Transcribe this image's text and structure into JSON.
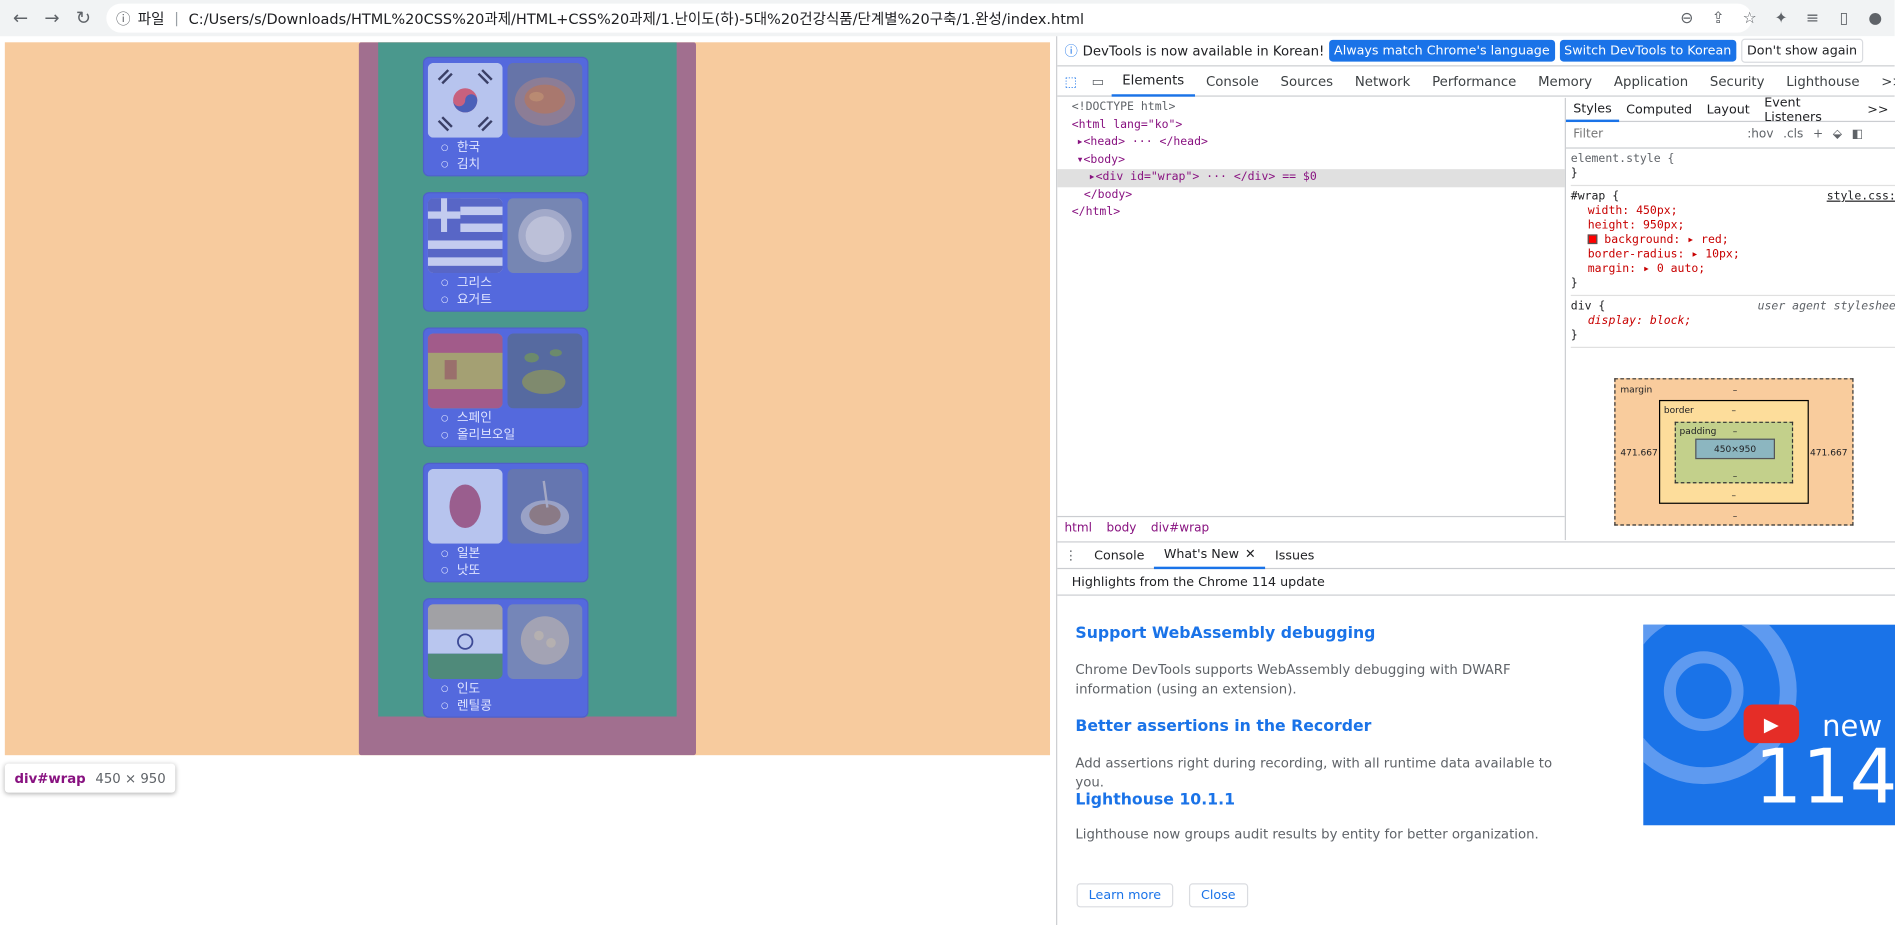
{
  "browser": {
    "url_prefix": "파일",
    "url": "C:/Users/s/Downloads/HTML%20CSS%20과제/HTML+CSS%20과제/1.난이도(하)-5대%20건강식품/단계별%20구축/1.완성/index.html"
  },
  "page": {
    "cards": [
      {
        "country": "한국",
        "food": "김치",
        "flag": "korea-flag-icon"
      },
      {
        "country": "그리스",
        "food": "요거트",
        "flag": "greece-flag-icon"
      },
      {
        "country": "스페인",
        "food": "올리브오일",
        "flag": "spain-flag-icon"
      },
      {
        "country": "일본",
        "food": "낫또",
        "flag": "japan-flag-icon"
      },
      {
        "country": "인도",
        "food": "렌틸콩",
        "flag": "india-flag-icon"
      }
    ],
    "tooltip": {
      "tag": "div#wrap",
      "size": "450 × 950"
    }
  },
  "devtools": {
    "info": {
      "message": "DevTools is now available in Korean!",
      "btn_match": "Always match Chrome's language",
      "btn_switch": "Switch DevTools to Korean",
      "btn_dismiss": "Don't show again"
    },
    "tabs": [
      "Elements",
      "Console",
      "Sources",
      "Network",
      "Performance",
      "Memory",
      "Application",
      "Security",
      "Lighthouse"
    ],
    "more": ">>",
    "dom": {
      "doctype": "<!DOCTYPE html>",
      "html_open": "<html lang=\"ko\">",
      "head": "<head> ··· </head>",
      "body_open": "<body>",
      "div_wrap": "<div id=\"wrap\"> ··· </div> == $0",
      "body_close": "</body>",
      "html_close": "</html>"
    },
    "breadcrumbs": [
      "html",
      "body",
      "div#wrap"
    ],
    "styles_tabs": [
      "Styles",
      "Computed",
      "Layout",
      "Event Listeners"
    ],
    "filter_placeholder": "Filter",
    "filter_hov": ":hov",
    "filter_cls": ".cls",
    "element_style": "element.style {",
    "wrap_rule": {
      "selector": "#wrap {",
      "source": "style.css:",
      "width": "width: 450px;",
      "height": "height: 950px;",
      "background": "background: ▸ red;",
      "radius": "border-radius: ▸ 10px;",
      "margin": "margin: ▸ 0 auto;"
    },
    "ua_rule": {
      "selector": "div {",
      "source": "user agent styleshee",
      "display": "display: block;"
    },
    "close_brace": "}",
    "box_model": {
      "margin": "margin",
      "border": "border",
      "padding": "padding",
      "content": "450×950",
      "left": "471.667",
      "right": "471.667",
      "dash": "–"
    },
    "drawer": {
      "tabs": [
        "Console",
        "What's New",
        "Issues"
      ],
      "highlights": "Highlights from the Chrome 114 update",
      "items": [
        {
          "title": "Support WebAssembly debugging",
          "text": "Chrome DevTools supports WebAssembly debugging with DWARF information (using an extension)."
        },
        {
          "title": "Better assertions in the Recorder",
          "text": "Add assertions right during recording, with all runtime data available to you."
        },
        {
          "title": "Lighthouse 10.1.1",
          "text": "Lighthouse now groups audit results by entity for better organization."
        }
      ],
      "video_new": "new",
      "video_version": "114",
      "learn_more": "Learn more",
      "close": "Close"
    }
  }
}
